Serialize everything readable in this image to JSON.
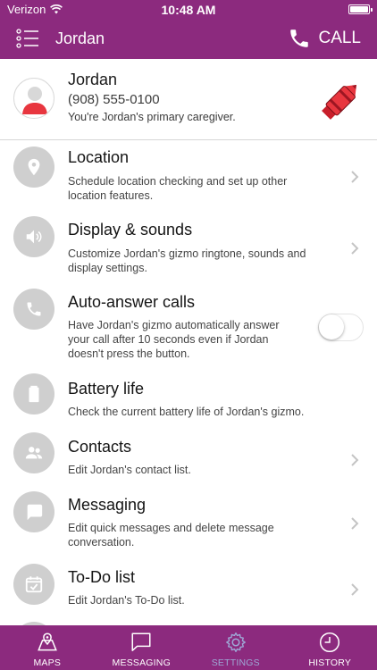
{
  "status_bar": {
    "carrier": "Verizon",
    "time": "10:48 AM"
  },
  "header": {
    "title": "Jordan",
    "call_label": "CALL"
  },
  "profile": {
    "name": "Jordan",
    "phone": "(908) 555-0100",
    "note": "You're Jordan's primary caregiver."
  },
  "settings": [
    {
      "title": "Location",
      "desc": "Schedule location checking and set up other location features."
    },
    {
      "title": "Display & sounds",
      "desc": "Customize Jordan's gizmo ringtone, sounds and display settings."
    },
    {
      "title": "Auto-answer calls",
      "desc": "Have Jordan's gizmo automatically answer your call after 10 seconds even if Jordan doesn't press the button.",
      "toggle_on": false
    },
    {
      "title": "Battery life",
      "desc": "Check the current battery life of Jordan's gizmo."
    },
    {
      "title": "Contacts",
      "desc": "Edit Jordan's contact list."
    },
    {
      "title": "Messaging",
      "desc": "Edit quick messages and delete message conversation."
    },
    {
      "title": "To-Do list",
      "desc": "Edit Jordan's To-Do list."
    }
  ],
  "tabs": [
    {
      "label": "MAPS",
      "icon": "map-icon"
    },
    {
      "label": "MESSAGING",
      "icon": "message-icon"
    },
    {
      "label": "SETTINGS",
      "icon": "gear-icon",
      "active": true
    },
    {
      "label": "HISTORY",
      "icon": "clock-icon"
    }
  ],
  "colors": {
    "brand": "#8c2a7e",
    "active_tab": "#9ea8d6",
    "icon_circle": "#cfcfcf",
    "avatar_shirt": "#e8363f"
  }
}
